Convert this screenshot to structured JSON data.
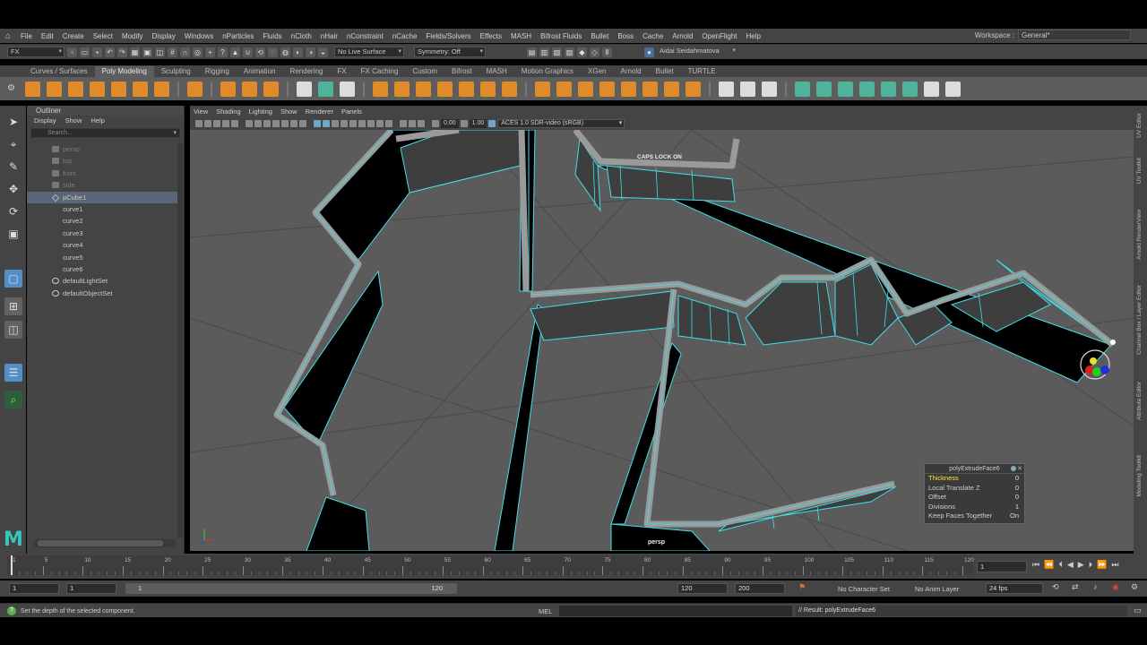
{
  "menubar": {
    "items": [
      "File",
      "Edit",
      "Create",
      "Select",
      "Modify",
      "Display",
      "Windows",
      "nParticles",
      "Fluids",
      "nCloth",
      "nHair",
      "nConstraint",
      "nCache",
      "Fields/Solvers",
      "Effects",
      "MASH",
      "Bifrost Fluids",
      "Bullet",
      "Boss",
      "Cache",
      "Arnold",
      "OpenFlight",
      "Help"
    ],
    "workspace_label": "Workspace :",
    "workspace_value": "General*"
  },
  "statusline": {
    "menuset": "FX",
    "live_surface": "No Live Surface",
    "symmetry": "Symmetry: Off",
    "user": "Aidai Seidahmatova"
  },
  "shelf": {
    "tabs": [
      "Curves / Surfaces",
      "Poly Modeling",
      "Sculpting",
      "Rigging",
      "Animation",
      "Rendering",
      "FX",
      "FX Caching",
      "Custom",
      "Bifrost",
      "MASH",
      "Motion Graphics",
      "XGen",
      "Arnold",
      "Bullet",
      "TURTLE"
    ],
    "active_tab": "Poly Modeling"
  },
  "outliner": {
    "title": "Outliner",
    "menu": [
      "Display",
      "Show",
      "Help"
    ],
    "search_placeholder": "Search...",
    "items": [
      {
        "label": "persp",
        "kind": "camera",
        "dim": true
      },
      {
        "label": "top",
        "kind": "camera",
        "dim": true
      },
      {
        "label": "front",
        "kind": "camera",
        "dim": true
      },
      {
        "label": "side",
        "kind": "camera",
        "dim": true
      },
      {
        "label": "pCube1",
        "kind": "mesh",
        "selected": true
      },
      {
        "label": "curve1",
        "kind": "curve"
      },
      {
        "label": "curve2",
        "kind": "curve"
      },
      {
        "label": "curve3",
        "kind": "curve"
      },
      {
        "label": "curve4",
        "kind": "curve"
      },
      {
        "label": "curve5",
        "kind": "curve"
      },
      {
        "label": "curve6",
        "kind": "curve"
      },
      {
        "label": "defaultLightSet",
        "kind": "set"
      },
      {
        "label": "defaultObjectSet",
        "kind": "set"
      }
    ]
  },
  "viewport": {
    "menu": [
      "View",
      "Shading",
      "Lighting",
      "Show",
      "Renderer",
      "Panels"
    ],
    "exposure": "0.00",
    "gamma": "1.00",
    "colorspace": "ACES 1.0 SDR-video (sRGB)",
    "caps_warning": "CAPS LOCK ON",
    "camera_label": "persp",
    "mesh_color": "#9a9a9a",
    "wire_color": "#3fe0e8",
    "bg_color": "#5b5b5b"
  },
  "hud": {
    "title": "polyExtrudeFace6",
    "rows": [
      {
        "label": "Thickness",
        "value": "0",
        "active": true
      },
      {
        "label": "Local Translate Z",
        "value": "0"
      },
      {
        "label": "Offset",
        "value": "0"
      },
      {
        "label": "Divisions",
        "value": "1"
      },
      {
        "label": "Keep Faces Together",
        "value": "On"
      }
    ]
  },
  "right_tabs": [
    "UV Editor",
    "UV Toolkit",
    "Arnold RenderView",
    "Channel Box / Layer Editor",
    "Attribute Editor",
    "Modeling Toolkit"
  ],
  "timeslider": {
    "ticks": [
      "1",
      "5",
      "10",
      "15",
      "20",
      "25",
      "30",
      "35",
      "40",
      "45",
      "50",
      "55",
      "60",
      "65",
      "70",
      "75",
      "80",
      "85",
      "90",
      "95",
      "100",
      "105",
      "110",
      "115",
      "120"
    ],
    "current_frame": "1"
  },
  "rangeslider": {
    "start": "1",
    "anim_start": "1",
    "range_start": "1",
    "range_end": "120",
    "end": "120",
    "anim_end": "200",
    "character_set": "No Character Set",
    "anim_layer": "No Anim Layer",
    "fps": "24 fps"
  },
  "cmdline": {
    "help": "Set the depth of the selected component.",
    "lang": "MEL",
    "result": "// Result: polyExtrudeFace6"
  }
}
